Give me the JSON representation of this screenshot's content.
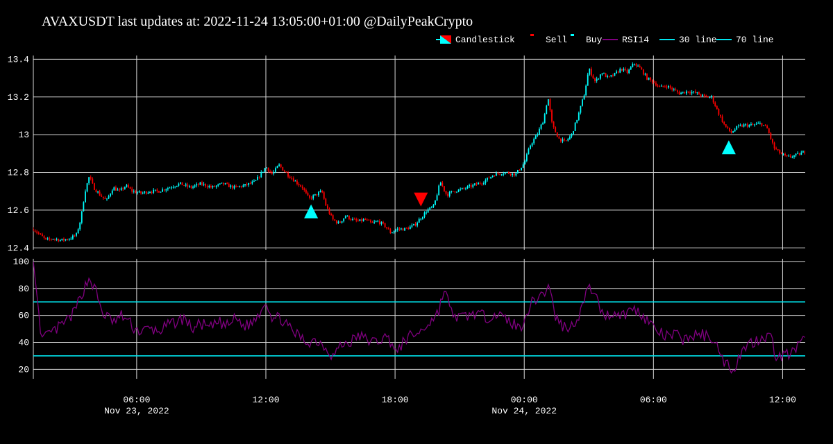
{
  "title": "AVAXUSDT last updates at: 2022-11-24 13:05:00+01:00 @DailyPeakCrypto",
  "colors": {
    "background": "#000000",
    "grid": "#d9d9d9",
    "candle_up": "#00ffff",
    "candle_down": "#ff0000",
    "rsi": "#800080",
    "threshold_line": "#00e5ee",
    "sell_marker": "#ff0000",
    "buy_marker": "#00ffff"
  },
  "legend": [
    {
      "label": "Candlestick",
      "kind": "candle"
    },
    {
      "label": "Sell",
      "kind": "sell"
    },
    {
      "label": "Buy",
      "kind": "buy"
    },
    {
      "label": "RSI14",
      "kind": "rsi"
    },
    {
      "label": "30 line",
      "kind": "line30"
    },
    {
      "label": "70 line",
      "kind": "line70"
    }
  ],
  "chart_data": [
    {
      "type": "candlestick",
      "title": "AVAXUSDT last updates at: 2022-11-24 13:05:00+01:00 @DailyPeakCrypto",
      "x_ticks": [
        {
          "label": "06:00",
          "sublabel": "Nov 23, 2022",
          "hour": 6
        },
        {
          "label": "12:00",
          "sublabel": "",
          "hour": 12
        },
        {
          "label": "18:00",
          "sublabel": "",
          "hour": 18
        },
        {
          "label": "00:00",
          "sublabel": "Nov 24, 2022",
          "hour": 24
        },
        {
          "label": "06:00",
          "sublabel": "",
          "hour": 30
        },
        {
          "label": "12:00",
          "sublabel": "",
          "hour": 36
        }
      ],
      "x_range_hours": [
        1.2,
        37.05
      ],
      "y_ticks": [
        "12.4",
        "12.6",
        "12.8",
        "13",
        "13.2",
        "13.4"
      ],
      "y_tick_values": [
        12.4,
        12.6,
        12.8,
        13.0,
        13.2,
        13.4
      ],
      "ylim": [
        12.39,
        13.42
      ],
      "price_path": [
        [
          1.2,
          12.5
        ],
        [
          1.5,
          12.47
        ],
        [
          1.8,
          12.44
        ],
        [
          2.1,
          12.45
        ],
        [
          2.5,
          12.44
        ],
        [
          2.9,
          12.45
        ],
        [
          3.2,
          12.47
        ],
        [
          3.4,
          12.55
        ],
        [
          3.6,
          12.7
        ],
        [
          3.8,
          12.78
        ],
        [
          4.0,
          12.72
        ],
        [
          4.3,
          12.68
        ],
        [
          4.6,
          12.65
        ],
        [
          4.9,
          12.72
        ],
        [
          5.2,
          12.7
        ],
        [
          5.5,
          12.73
        ],
        [
          5.8,
          12.7
        ],
        [
          6.2,
          12.69
        ],
        [
          6.6,
          12.7
        ],
        [
          7.0,
          12.7
        ],
        [
          7.5,
          12.72
        ],
        [
          8.0,
          12.74
        ],
        [
          8.5,
          12.72
        ],
        [
          9.0,
          12.74
        ],
        [
          9.5,
          12.72
        ],
        [
          10.0,
          12.74
        ],
        [
          10.5,
          12.72
        ],
        [
          11.0,
          12.73
        ],
        [
          11.5,
          12.75
        ],
        [
          12.0,
          12.83
        ],
        [
          12.3,
          12.79
        ],
        [
          12.6,
          12.84
        ],
        [
          13.0,
          12.79
        ],
        [
          13.4,
          12.75
        ],
        [
          13.7,
          12.72
        ],
        [
          14.0,
          12.66
        ],
        [
          14.3,
          12.68
        ],
        [
          14.6,
          12.7
        ],
        [
          14.8,
          12.62
        ],
        [
          15.1,
          12.55
        ],
        [
          15.4,
          12.53
        ],
        [
          15.7,
          12.57
        ],
        [
          16.0,
          12.55
        ],
        [
          16.3,
          12.54
        ],
        [
          16.6,
          12.55
        ],
        [
          16.9,
          12.53
        ],
        [
          17.2,
          12.54
        ],
        [
          17.5,
          12.52
        ],
        [
          17.8,
          12.48
        ],
        [
          18.1,
          12.5
        ],
        [
          18.5,
          12.5
        ],
        [
          18.9,
          12.52
        ],
        [
          19.2,
          12.56
        ],
        [
          19.5,
          12.6
        ],
        [
          19.8,
          12.62
        ],
        [
          20.1,
          12.75
        ],
        [
          20.4,
          12.68
        ],
        [
          20.7,
          12.7
        ],
        [
          21.1,
          12.71
        ],
        [
          21.6,
          12.73
        ],
        [
          22.1,
          12.75
        ],
        [
          22.6,
          12.79
        ],
        [
          23.1,
          12.8
        ],
        [
          23.6,
          12.79
        ],
        [
          24.0,
          12.85
        ],
        [
          24.3,
          12.95
        ],
        [
          24.6,
          13.0
        ],
        [
          24.9,
          13.08
        ],
        [
          25.1,
          13.2
        ],
        [
          25.3,
          13.05
        ],
        [
          25.6,
          12.98
        ],
        [
          25.9,
          12.96
        ],
        [
          26.2,
          13.0
        ],
        [
          26.5,
          13.1
        ],
        [
          26.8,
          13.22
        ],
        [
          27.0,
          13.35
        ],
        [
          27.3,
          13.28
        ],
        [
          27.6,
          13.33
        ],
        [
          27.9,
          13.3
        ],
        [
          28.2,
          13.32
        ],
        [
          28.5,
          13.35
        ],
        [
          28.8,
          13.33
        ],
        [
          29.1,
          13.38
        ],
        [
          29.4,
          13.35
        ],
        [
          29.7,
          13.3
        ],
        [
          30.0,
          13.28
        ],
        [
          30.3,
          13.25
        ],
        [
          30.6,
          13.26
        ],
        [
          30.9,
          13.24
        ],
        [
          31.2,
          13.22
        ],
        [
          31.6,
          13.23
        ],
        [
          32.0,
          13.22
        ],
        [
          32.4,
          13.2
        ],
        [
          32.7,
          13.2
        ],
        [
          33.0,
          13.12
        ],
        [
          33.3,
          13.05
        ],
        [
          33.6,
          13.01
        ],
        [
          33.9,
          13.04
        ],
        [
          34.2,
          13.05
        ],
        [
          34.6,
          13.05
        ],
        [
          35.0,
          13.06
        ],
        [
          35.3,
          13.03
        ],
        [
          35.6,
          12.93
        ],
        [
          35.9,
          12.9
        ],
        [
          36.2,
          12.88
        ],
        [
          36.6,
          12.89
        ],
        [
          37.05,
          12.91
        ]
      ],
      "volatility": 0.018,
      "candle_interval_minutes": 5,
      "signals": [
        {
          "type": "buy",
          "hour": 14.1,
          "price": 12.59
        },
        {
          "type": "sell",
          "hour": 19.2,
          "price": 12.66
        },
        {
          "type": "buy",
          "hour": 33.5,
          "price": 12.93
        }
      ]
    },
    {
      "type": "line",
      "series": [
        {
          "name": "RSI14",
          "path": [
            [
              1.2,
              100
            ],
            [
              1.4,
              70
            ],
            [
              1.6,
              42
            ],
            [
              1.9,
              45
            ],
            [
              2.3,
              50
            ],
            [
              2.7,
              55
            ],
            [
              3.1,
              62
            ],
            [
              3.5,
              78
            ],
            [
              3.8,
              88
            ],
            [
              4.1,
              78
            ],
            [
              4.4,
              62
            ],
            [
              4.7,
              58
            ],
            [
              5.0,
              55
            ],
            [
              5.3,
              60
            ],
            [
              5.6,
              56
            ],
            [
              5.9,
              50
            ],
            [
              6.2,
              48
            ],
            [
              6.6,
              50
            ],
            [
              7.0,
              48
            ],
            [
              7.4,
              52
            ],
            [
              7.8,
              55
            ],
            [
              8.2,
              58
            ],
            [
              8.6,
              50
            ],
            [
              9.0,
              54
            ],
            [
              9.4,
              50
            ],
            [
              9.8,
              55
            ],
            [
              10.2,
              52
            ],
            [
              10.6,
              58
            ],
            [
              11.0,
              52
            ],
            [
              11.4,
              55
            ],
            [
              11.8,
              65
            ],
            [
              12.0,
              72
            ],
            [
              12.3,
              58
            ],
            [
              12.7,
              58
            ],
            [
              13.1,
              50
            ],
            [
              13.5,
              45
            ],
            [
              13.9,
              40
            ],
            [
              14.3,
              42
            ],
            [
              14.7,
              38
            ],
            [
              15.1,
              30
            ],
            [
              15.5,
              38
            ],
            [
              15.9,
              40
            ],
            [
              16.3,
              45
            ],
            [
              16.7,
              42
            ],
            [
              17.1,
              40
            ],
            [
              17.5,
              44
            ],
            [
              17.9,
              40
            ],
            [
              18.1,
              30
            ],
            [
              18.4,
              42
            ],
            [
              18.8,
              45
            ],
            [
              19.2,
              48
            ],
            [
              19.6,
              55
            ],
            [
              20.0,
              62
            ],
            [
              20.3,
              80
            ],
            [
              20.6,
              62
            ],
            [
              21.0,
              58
            ],
            [
              21.4,
              60
            ],
            [
              21.8,
              62
            ],
            [
              22.2,
              58
            ],
            [
              22.6,
              62
            ],
            [
              23.0,
              58
            ],
            [
              23.4,
              55
            ],
            [
              23.8,
              50
            ],
            [
              24.1,
              62
            ],
            [
              24.4,
              70
            ],
            [
              24.7,
              75
            ],
            [
              25.0,
              78
            ],
            [
              25.2,
              82
            ],
            [
              25.4,
              60
            ],
            [
              25.8,
              52
            ],
            [
              26.2,
              52
            ],
            [
              26.6,
              62
            ],
            [
              26.9,
              78
            ],
            [
              27.2,
              80
            ],
            [
              27.5,
              65
            ],
            [
              27.8,
              60
            ],
            [
              28.2,
              62
            ],
            [
              28.6,
              60
            ],
            [
              29.0,
              65
            ],
            [
              29.4,
              62
            ],
            [
              29.8,
              55
            ],
            [
              30.2,
              48
            ],
            [
              30.6,
              44
            ],
            [
              31.0,
              46
            ],
            [
              31.4,
              42
            ],
            [
              31.8,
              45
            ],
            [
              32.2,
              46
            ],
            [
              32.6,
              44
            ],
            [
              32.9,
              42
            ],
            [
              33.1,
              28
            ],
            [
              33.4,
              25
            ],
            [
              33.7,
              20
            ],
            [
              34.0,
              30
            ],
            [
              34.3,
              38
            ],
            [
              34.6,
              40
            ],
            [
              35.0,
              44
            ],
            [
              35.4,
              46
            ],
            [
              35.7,
              30
            ],
            [
              36.0,
              30
            ],
            [
              36.4,
              32
            ],
            [
              36.8,
              38
            ],
            [
              37.05,
              42
            ]
          ]
        },
        {
          "name": "30 line",
          "value": 30
        },
        {
          "name": "70 line",
          "value": 70
        }
      ],
      "y_ticks": [
        "20",
        "40",
        "60",
        "80",
        "100"
      ],
      "y_tick_values": [
        20,
        40,
        60,
        80,
        100
      ],
      "ylim": [
        13,
        102
      ]
    }
  ]
}
